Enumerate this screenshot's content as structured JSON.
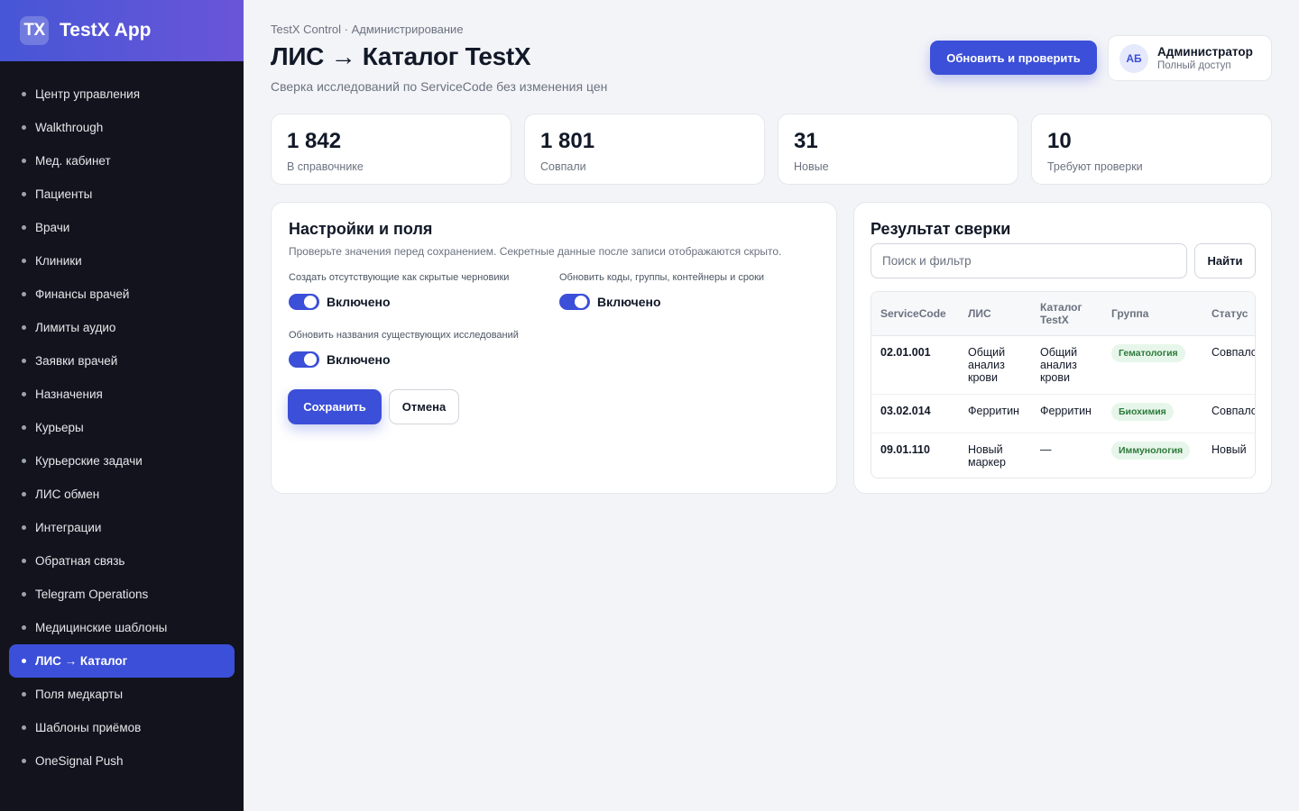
{
  "brand": {
    "logo": "TX",
    "name": "TestX App"
  },
  "sidebar": {
    "items": [
      {
        "label": "Центр управления",
        "active": false
      },
      {
        "label": "Walkthrough",
        "active": false
      },
      {
        "label": "Мед. кабинет",
        "active": false
      },
      {
        "label": "Пациенты",
        "active": false
      },
      {
        "label": "Врачи",
        "active": false
      },
      {
        "label": "Клиники",
        "active": false
      },
      {
        "label": "Финансы врачей",
        "active": false
      },
      {
        "label": "Лимиты аудио",
        "active": false
      },
      {
        "label": "Заявки врачей",
        "active": false
      },
      {
        "label": "Назначения",
        "active": false
      },
      {
        "label": "Курьеры",
        "active": false
      },
      {
        "label": "Курьерские задачи",
        "active": false
      },
      {
        "label": "ЛИС обмен",
        "active": false
      },
      {
        "label": "Интеграции",
        "active": false
      },
      {
        "label": "Обратная связь",
        "active": false
      },
      {
        "label": "Telegram Operations",
        "active": false
      },
      {
        "label": "Медицинские шаблоны",
        "active": false
      },
      {
        "label": "ЛИС → Каталог",
        "active": true
      },
      {
        "label": "Поля медкарты",
        "active": false
      },
      {
        "label": "Шаблоны приёмов",
        "active": false
      },
      {
        "label": "OneSignal Push",
        "active": false
      }
    ]
  },
  "header": {
    "breadcrumb": "TestX Control · Администрирование",
    "title": "ЛИС → Каталог TestX",
    "subtitle": "Сверка исследований по ServiceCode без изменения цен",
    "refresh_label": "Обновить и проверить",
    "user": {
      "initials": "АБ",
      "name": "Администратор",
      "role": "Полный доступ"
    }
  },
  "stats": [
    {
      "value": "1 842",
      "label": "В справочнике"
    },
    {
      "value": "1 801",
      "label": "Совпали"
    },
    {
      "value": "31",
      "label": "Новые"
    },
    {
      "value": "10",
      "label": "Требуют проверки"
    }
  ],
  "settings": {
    "title": "Настройки и поля",
    "description": "Проверьте значения перед сохранением. Секретные данные после записи отображаются скрыто.",
    "fields": [
      {
        "label": "Создать отсутствующие как скрытые черновики",
        "state": "Включено",
        "on": true
      },
      {
        "label": "Обновить коды, группы, контейнеры и сроки",
        "state": "Включено",
        "on": true
      },
      {
        "label": "Обновить названия существующих исследований",
        "state": "Включено",
        "on": true
      }
    ],
    "save_label": "Сохранить",
    "cancel_label": "Отмена"
  },
  "result": {
    "title": "Результат сверки",
    "search_placeholder": "Поиск и фильтр",
    "find_label": "Найти",
    "columns": [
      "ServiceCode",
      "ЛИС",
      "Каталог TestX",
      "Группа",
      "Статус"
    ],
    "rows": [
      {
        "code": "02.01.001",
        "lis": "Общий анализ крови",
        "catalog": "Общий анализ крови",
        "group": "Гематология",
        "status": "Совпало"
      },
      {
        "code": "03.02.014",
        "lis": "Ферритин",
        "catalog": "Ферритин",
        "group": "Биохимия",
        "status": "Совпало"
      },
      {
        "code": "09.01.110",
        "lis": "Новый маркер",
        "catalog": "—",
        "group": "Иммунология",
        "status": "Новый"
      }
    ]
  },
  "colors": {
    "accent": "#3b4fd8",
    "sidebar_bg": "#12131c",
    "badge_bg": "#e7f6ea",
    "badge_text": "#2d7a3b"
  },
  "icons": {
    "nav_bullet": "dot-icon"
  }
}
